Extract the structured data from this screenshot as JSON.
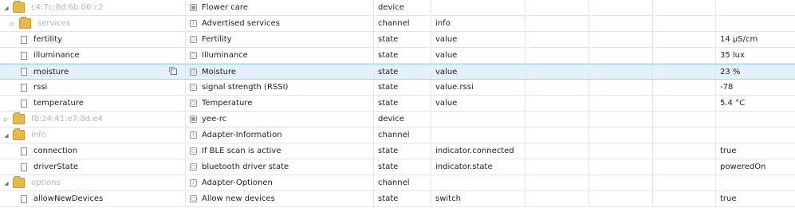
{
  "rows": [
    {
      "id": "c4:7c:8d:6b:06:c2",
      "name": "Flower care",
      "type": "device",
      "role": "",
      "value": ""
    },
    {
      "id": "services",
      "name": "Advertised services",
      "type": "channel",
      "role": "info",
      "value": ""
    },
    {
      "id": "fertility",
      "name": "Fertility",
      "type": "state",
      "role": "value",
      "value": "14 µS/cm"
    },
    {
      "id": "illuminance",
      "name": "Illuminance",
      "type": "state",
      "role": "value",
      "value": "35 lux"
    },
    {
      "id": "moisture",
      "name": "Moisture",
      "type": "state",
      "role": "value",
      "value": "23 %"
    },
    {
      "id": "rssi",
      "name": "signal strength (RSSI)",
      "type": "state",
      "role": "value.rssi",
      "value": "-78"
    },
    {
      "id": "temperature",
      "name": "Temperature",
      "type": "state",
      "role": "value",
      "value": "5.4 °C"
    },
    {
      "id": "f8:24:41:e7:8d:e4",
      "name": "yee-rc",
      "type": "device",
      "role": "",
      "value": ""
    },
    {
      "id": "info",
      "name": "Adapter-Information",
      "type": "channel",
      "role": "",
      "value": ""
    },
    {
      "id": "connection",
      "name": "If BLE scan is active",
      "type": "state",
      "role": "indicator.connected",
      "value": "true"
    },
    {
      "id": "driverState",
      "name": "bluetooth driver state",
      "type": "state",
      "role": "indicator.state",
      "value": "poweredOn"
    },
    {
      "id": "options",
      "name": "Adapter-Optionen",
      "type": "channel",
      "role": "",
      "value": ""
    },
    {
      "id": "allowNewDevices",
      "name": "Allow new devices",
      "type": "state",
      "role": "switch",
      "value": "true"
    }
  ]
}
